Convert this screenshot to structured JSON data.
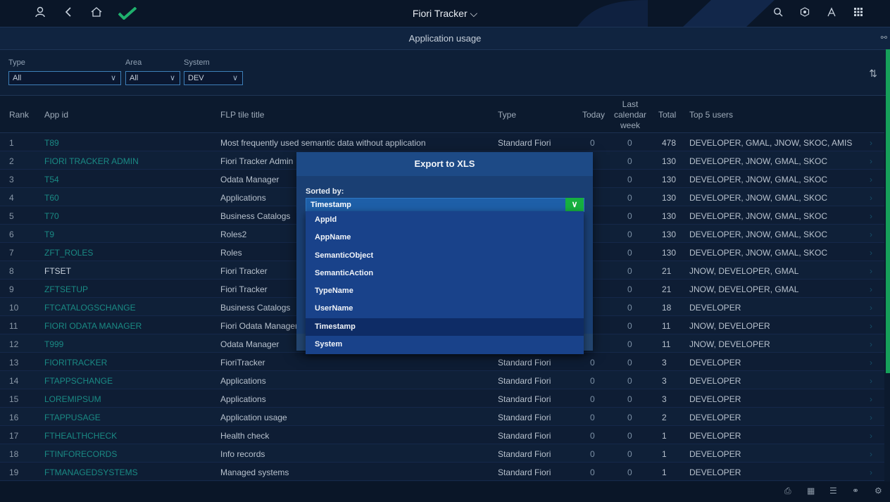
{
  "shell": {
    "title": "Fiori Tracker",
    "icons": [
      "user-icon",
      "back-icon",
      "home-icon",
      "logo",
      "search-icon",
      "notifications-icon",
      "copilot-icon",
      "apps-icon"
    ]
  },
  "subheader": {
    "title": "Application usage"
  },
  "filters": {
    "type": {
      "label": "Type",
      "value": "All"
    },
    "area": {
      "label": "Area",
      "value": "All"
    },
    "system": {
      "label": "System",
      "value": "DEV"
    }
  },
  "columns": {
    "rank": "Rank",
    "app_id": "App id",
    "flp": "FLP tile title",
    "type": "Type",
    "today": "Today",
    "last_week_1": "Last",
    "last_week_2": "calendar",
    "last_week_3": "week",
    "total": "Total",
    "users": "Top 5 users"
  },
  "rows": [
    {
      "rank": "1",
      "app": "T89",
      "flp": "Most frequently used semantic data without application",
      "type": "Standard Fiori",
      "today": "0",
      "last": "0",
      "total": "478",
      "users": "DEVELOPER, GMAL, JNOW, SKOC, AMIS"
    },
    {
      "rank": "2",
      "app": "FIORI TRACKER ADMIN",
      "flp": "Fiori Tracker Admin",
      "type": "",
      "today": "",
      "last": "0",
      "total": "130",
      "users": "DEVELOPER, JNOW, GMAL, SKOC"
    },
    {
      "rank": "3",
      "app": "T54",
      "flp": "Odata Manager",
      "type": "",
      "today": "",
      "last": "0",
      "total": "130",
      "users": "DEVELOPER, JNOW, GMAL, SKOC"
    },
    {
      "rank": "4",
      "app": "T60",
      "flp": "Applications",
      "type": "",
      "today": "",
      "last": "0",
      "total": "130",
      "users": "DEVELOPER, JNOW, GMAL, SKOC"
    },
    {
      "rank": "5",
      "app": "T70",
      "flp": "Business Catalogs",
      "type": "",
      "today": "",
      "last": "0",
      "total": "130",
      "users": "DEVELOPER, JNOW, GMAL, SKOC"
    },
    {
      "rank": "6",
      "app": "T9",
      "flp": "Roles2",
      "type": "",
      "today": "",
      "last": "0",
      "total": "130",
      "users": "DEVELOPER, JNOW, GMAL, SKOC"
    },
    {
      "rank": "7",
      "app": "ZFT_ROLES",
      "flp": "Roles",
      "type": "",
      "today": "",
      "last": "0",
      "total": "130",
      "users": "DEVELOPER, JNOW, GMAL, SKOC"
    },
    {
      "rank": "8",
      "app": "FTSET",
      "flp": "Fiori Tracker",
      "type": "",
      "today": "",
      "last": "0",
      "total": "21",
      "users": "JNOW, DEVELOPER, GMAL"
    },
    {
      "rank": "9",
      "app": "ZFTSETUP",
      "flp": "Fiori Tracker",
      "type": "",
      "today": "",
      "last": "0",
      "total": "21",
      "users": "JNOW, DEVELOPER, GMAL"
    },
    {
      "rank": "10",
      "app": "FTCATALOGSCHANGE",
      "flp": "Business Catalogs",
      "type": "",
      "today": "",
      "last": "0",
      "total": "18",
      "users": "DEVELOPER"
    },
    {
      "rank": "11",
      "app": "FIORI ODATA MANAGER",
      "flp": "Fiori Odata Manager",
      "type": "",
      "today": "",
      "last": "0",
      "total": "11",
      "users": "JNOW, DEVELOPER"
    },
    {
      "rank": "12",
      "app": "T999",
      "flp": "Odata Manager",
      "type": "",
      "today": "",
      "last": "0",
      "total": "11",
      "users": "JNOW, DEVELOPER"
    },
    {
      "rank": "13",
      "app": "FIORITRACKER",
      "flp": "FioriTracker",
      "type": "Standard Fiori",
      "today": "0",
      "last": "0",
      "total": "3",
      "users": "DEVELOPER"
    },
    {
      "rank": "14",
      "app": "FTAPPSCHANGE",
      "flp": "Applications",
      "type": "Standard Fiori",
      "today": "0",
      "last": "0",
      "total": "3",
      "users": "DEVELOPER"
    },
    {
      "rank": "15",
      "app": "LOREMIPSUM",
      "flp": "Applications",
      "type": "Standard Fiori",
      "today": "0",
      "last": "0",
      "total": "3",
      "users": "DEVELOPER"
    },
    {
      "rank": "16",
      "app": "FTAPPUSAGE",
      "flp": "Application usage",
      "type": "Standard Fiori",
      "today": "0",
      "last": "0",
      "total": "2",
      "users": "DEVELOPER"
    },
    {
      "rank": "17",
      "app": "FTHEALTHCHECK",
      "flp": "Health check",
      "type": "Standard Fiori",
      "today": "0",
      "last": "0",
      "total": "1",
      "users": "DEVELOPER"
    },
    {
      "rank": "18",
      "app": "FTINFORECORDS",
      "flp": "Info records",
      "type": "Standard Fiori",
      "today": "0",
      "last": "0",
      "total": "1",
      "users": "DEVELOPER"
    },
    {
      "rank": "19",
      "app": "FTMANAGEDSYSTEMS",
      "flp": "Managed systems",
      "type": "Standard Fiori",
      "today": "0",
      "last": "0",
      "total": "1",
      "users": "DEVELOPER"
    }
  ],
  "dialog": {
    "title": "Export to XLS",
    "sorted_label": "Sorted by:",
    "selected": "Timestamp",
    "options": [
      "AppId",
      "AppName",
      "SemanticObject",
      "SemanticAction",
      "TypeName",
      "UserName",
      "Timestamp",
      "System"
    ]
  },
  "colors": {
    "accent": "#1a8a84",
    "shell": "#0a1628",
    "dialog": "#1a3f73",
    "ok_green": "#16b040"
  }
}
